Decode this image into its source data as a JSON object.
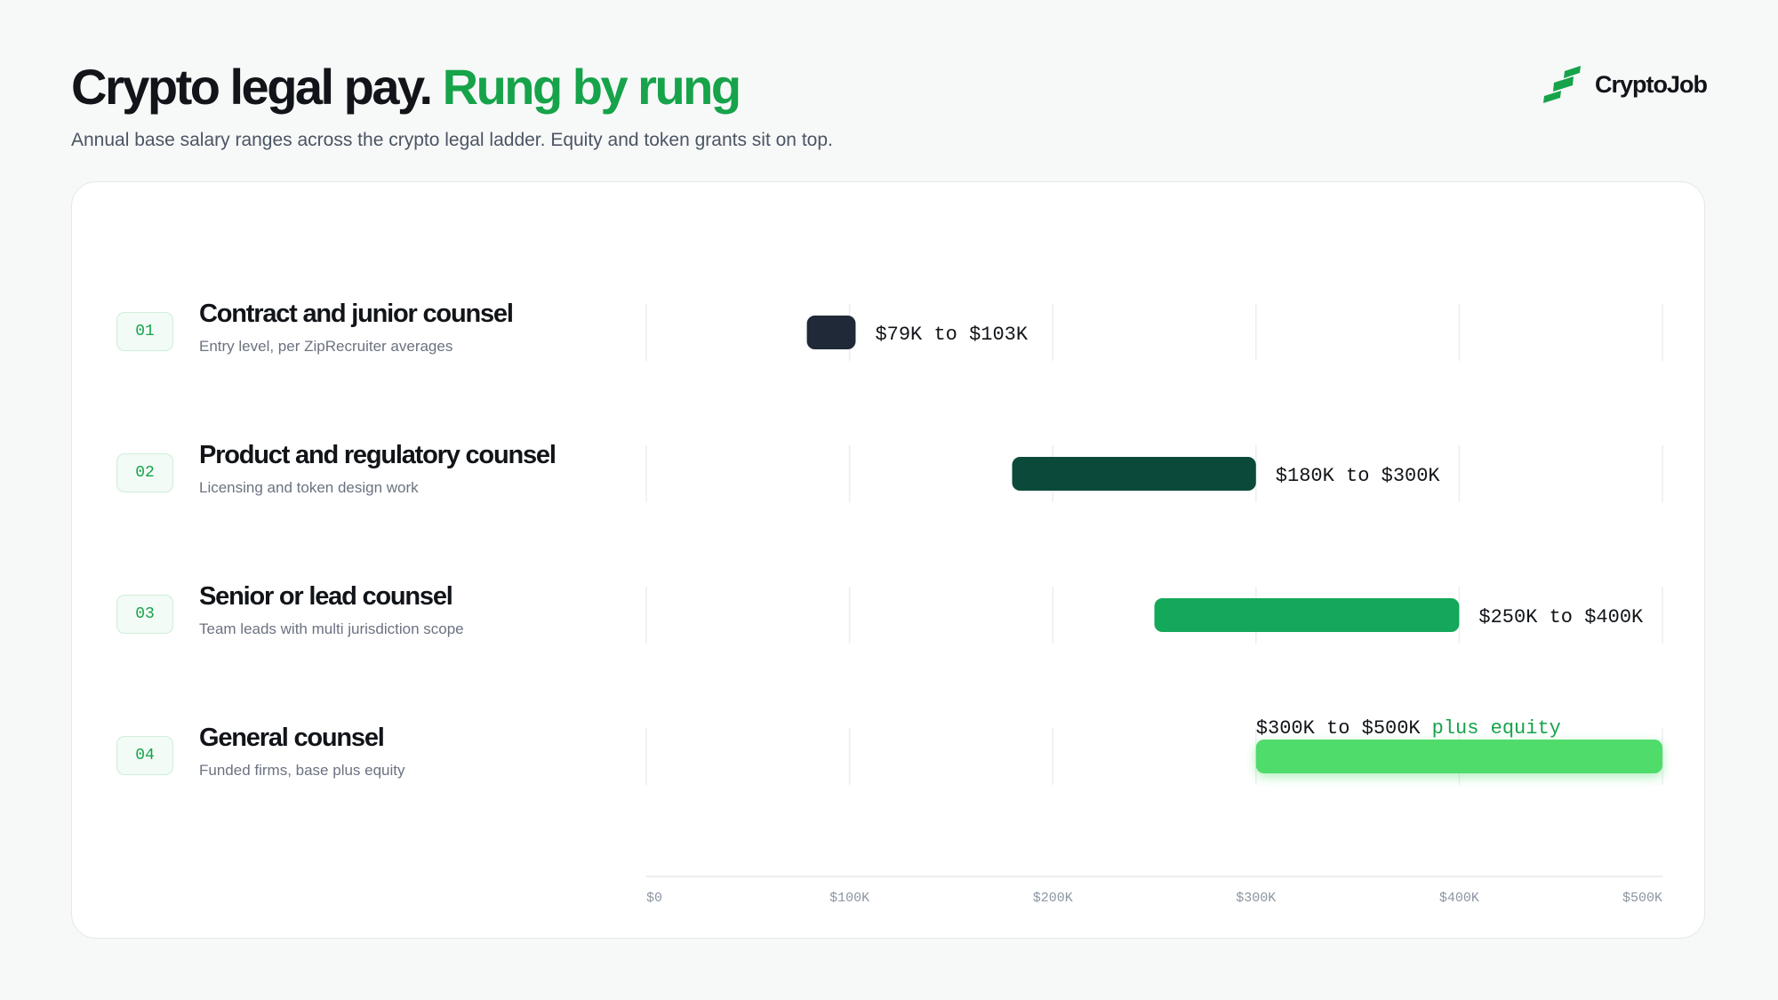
{
  "header": {
    "title_main": "Crypto legal pay.",
    "title_accent": "Rung by rung",
    "subtitle": "Annual base salary ranges across the crypto legal ladder. Equity and token grants sit on top."
  },
  "brand": {
    "name": "CryptoJob",
    "icon": "brand-logo-icon"
  },
  "colors": {
    "accent": "#16a34a",
    "rung_1": "#1f2937",
    "rung_2": "#0b4a3a",
    "rung_3": "#14a85a",
    "rung_4": "#4fdc6a"
  },
  "chart_data": {
    "type": "bar",
    "orientation": "horizontal-range",
    "xlim": [
      0,
      500000
    ],
    "x_ticks": [
      {
        "value": 0,
        "label": "$0"
      },
      {
        "value": 100000,
        "label": "$100K"
      },
      {
        "value": 200000,
        "label": "$200K"
      },
      {
        "value": 300000,
        "label": "$300K"
      },
      {
        "value": 400000,
        "label": "$400K"
      },
      {
        "value": 500000,
        "label": "$500K"
      }
    ],
    "grid": true,
    "rungs": [
      {
        "number": "01",
        "title": "Contract and junior counsel",
        "subtitle": "Entry level, per ZipRecruiter averages",
        "low": 79000,
        "high": 103000,
        "range_label": "$79K to $103K",
        "note": "",
        "color": "#1f2937"
      },
      {
        "number": "02",
        "title": "Product and regulatory counsel",
        "subtitle": "Licensing and token design work",
        "low": 180000,
        "high": 300000,
        "range_label": "$180K to $300K",
        "note": "",
        "color": "#0b4a3a"
      },
      {
        "number": "03",
        "title": "Senior or lead counsel",
        "subtitle": "Team leads with multi jurisdiction scope",
        "low": 250000,
        "high": 400000,
        "range_label": "$250K to $400K",
        "note": "",
        "color": "#14a85a"
      },
      {
        "number": "04",
        "title": "General counsel",
        "subtitle": "Funded firms, base plus equity",
        "low": 300000,
        "high": 500000,
        "range_label": "$300K to $500K",
        "note": "plus equity",
        "color": "#4fdc6a"
      }
    ]
  }
}
